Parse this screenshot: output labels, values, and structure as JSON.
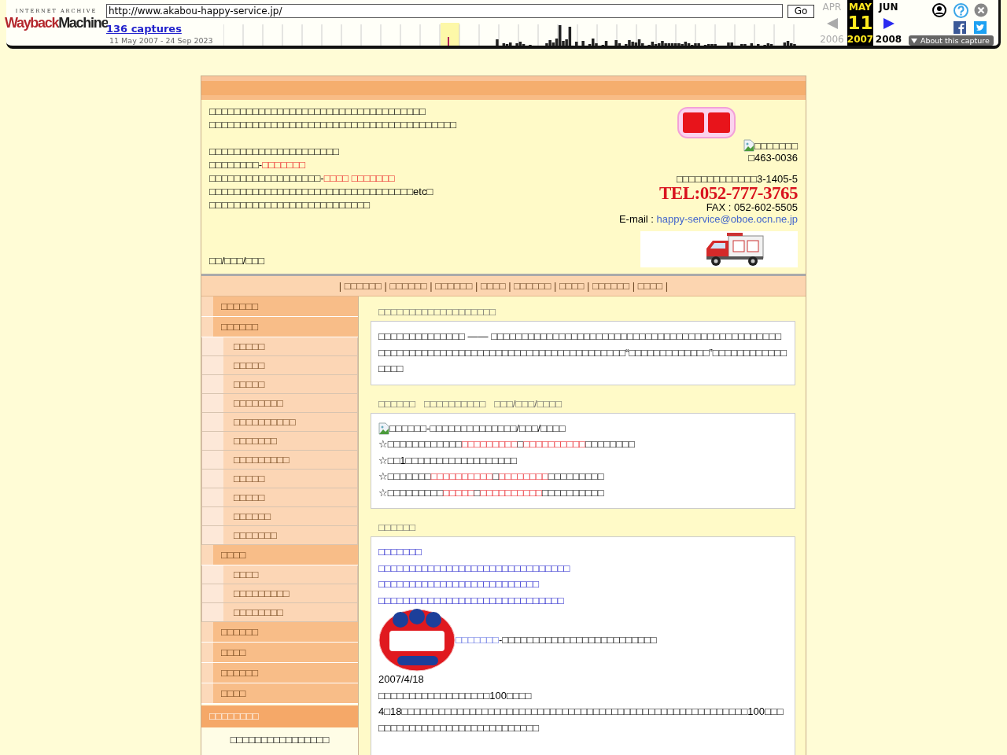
{
  "wayback": {
    "logo_caption": "INTERNET ARCHIVE",
    "logo_wordmark": "WaybackMachine",
    "url": "http://www.akabou-happy-service.jp/",
    "go": "Go",
    "captures": "136 captures",
    "range": "11 May 2007 - 24 Sep 2023",
    "columns": [
      {
        "month": "APR",
        "year": "2006",
        "selected": false,
        "disabled": true
      },
      {
        "month": "MAY",
        "year": "2007",
        "selected": true,
        "disabled": false,
        "day": "11"
      },
      {
        "month": "JUN",
        "year": "2008",
        "selected": false,
        "disabled": false
      }
    ],
    "about": "About this capture"
  },
  "header": {
    "intro": [
      "□□□□□□□□□□□□□□□□□□□□□□□□□□□□□□□□□□□",
      "□□□□□□□□□□□□□□□□□□□□□□□□□□□□□□□□□□□□□□□□"
    ],
    "details": [
      [
        {
          "text": "□□□□□□□□□□□□□□□□□□□□□",
          "highlight": false
        }
      ],
      [
        {
          "text": "□□□□□□□□-",
          "highlight": false
        },
        {
          "text": "□□□□□□□",
          "highlight": true
        }
      ],
      [
        {
          "text": "□□□□□□□□□□□□□□□□□□-",
          "highlight": false
        },
        {
          "text": "□□□□  □□□□□□□",
          "highlight": true
        }
      ],
      [
        {
          "text": "□□□□□□□□□□□□□□□□□□□□□□□□□□□□□□□□□etc□",
          "highlight": false
        }
      ],
      [
        {
          "text": "□□□□□□□□□□□□□□□□□□□□□□□□□□",
          "highlight": false
        }
      ]
    ],
    "tagline": "□□/□□□/□□□",
    "image_alt": "□□□□□□□",
    "postal": "□463-0036",
    "address": "□□□□□□□□□□□□□3-1405-5",
    "tel": "TEL:052-777-3765",
    "fax": "FAX : 052-602-5505",
    "email_label": "E-mail :",
    "email": "happy-service@oboe.ocn.ne.jp"
  },
  "nav_separator": "|",
  "nav": [
    "□□□□□□",
    "□□□□□□",
    "□□□□□□",
    "□□□□",
    "□□□□□□",
    "□□□□",
    "□□□□□□",
    "□□□□"
  ],
  "sidebar": {
    "items": [
      {
        "label": "□□□□□□",
        "kind": "top"
      },
      {
        "label": "□□□□□□",
        "kind": "top"
      },
      {
        "label": "□□□□□",
        "kind": "sub"
      },
      {
        "label": "□□□□□",
        "kind": "sub"
      },
      {
        "label": "□□□□□",
        "kind": "sub"
      },
      {
        "label": "□□□□□□□□",
        "kind": "sub"
      },
      {
        "label": "□□□□□□□□□□",
        "kind": "sub"
      },
      {
        "label": "□□□□□□□",
        "kind": "sub"
      },
      {
        "label": "□□□□□□□□□",
        "kind": "sub"
      },
      {
        "label": "□□□□□",
        "kind": "sub"
      },
      {
        "label": "□□□□□",
        "kind": "sub"
      },
      {
        "label": "□□□□□□",
        "kind": "sub"
      },
      {
        "label": "□□□□□□□",
        "kind": "sub"
      },
      {
        "label": "□□□□",
        "kind": "top"
      },
      {
        "label": "□□□□",
        "kind": "sub"
      },
      {
        "label": "□□□□□□□□□",
        "kind": "sub"
      },
      {
        "label": "□□□□□□□□",
        "kind": "sub"
      },
      {
        "label": "□□□□□□",
        "kind": "top"
      },
      {
        "label": "□□□□",
        "kind": "top"
      },
      {
        "label": "□□□□□□",
        "kind": "top"
      },
      {
        "label": "□□□□",
        "kind": "top"
      },
      {
        "label": "□□□□□□□□",
        "kind": "heading"
      }
    ],
    "note": "□□□□□□□□□□□□□□□□"
  },
  "about": {
    "title": "□□□□□□□□□□□□□□□□□□□",
    "text": "□□□□□□□□□□□□□□ —— □□□□□□□□□□□□□□□□□□□□□□□□□□□□□□□□□□□□□□□□□□□□□□□□□□□□□□□□□□□□□□□□□□□□□□□□□□□□□□□□□□□□□□□“□□□□□□□□□□□□□”□□□□□□□□□□□□□□□□"
  },
  "features": {
    "title": "□□□□□□   □□□□□□□□□□   □□□/□□□/□□□□",
    "image_alt": "□□□□□□-□□□□□□□□□□□□□□/□□□/□□□□",
    "lines": [
      [
        {
          "text": "☆□□□□□□□□□□□□",
          "highlight": false
        },
        {
          "text": "□□□□□□□□□",
          "highlight": true
        },
        {
          "text": "□",
          "highlight": false
        },
        {
          "text": "□□□□□□□□□□",
          "highlight": true
        },
        {
          "text": "□□□□□□□□",
          "highlight": false
        }
      ],
      [
        {
          "text": "☆□□1□□□□□□□□□□□□□□□□□□",
          "highlight": false
        }
      ],
      [
        {
          "text": "☆□□□□□□□",
          "highlight": false
        },
        {
          "text": "□□□□□□□□□□",
          "highlight": true
        },
        {
          "text": "□",
          "highlight": false
        },
        {
          "text": "□□□□□□□□",
          "highlight": true
        },
        {
          "text": "□□□□□□□□□",
          "highlight": false
        }
      ],
      [
        {
          "text": "☆□□□□□□□□□",
          "highlight": false
        },
        {
          "text": "□□□□□",
          "highlight": true
        },
        {
          "text": "□",
          "highlight": false
        },
        {
          "text": "□□□□□□□□□□",
          "highlight": true
        },
        {
          "text": "□□□□□□□□□□",
          "highlight": false
        }
      ]
    ]
  },
  "news": {
    "title": "□□□□□□",
    "links": [
      "□□□□□□□",
      "□□□□□□□□□□□□□□□□□□□□□□□□□□□□□□□",
      "□□□□□□□□□□□□□□□□□□□□□□□□□□",
      "□□□□□□□□□□□□□□□□□□□□□□□□□□□□□□"
    ],
    "badge_link": "□□□□□□□",
    "badge_text": "-□□□□□□□□□□□□□□□□□□□□□□□□□",
    "date": "2007/4/18",
    "headline": "□□□□□□□□□□□□□□□□□□100□□□□",
    "body": "4□18□□□□□□□□□□□□□□□□□□□□□□□□□□□□□□□□□□□□□□□□□□□□□□□□□□□□□□□□100□□□□□□□□□□□□□□□□□□□□□□□□□□□□□"
  }
}
